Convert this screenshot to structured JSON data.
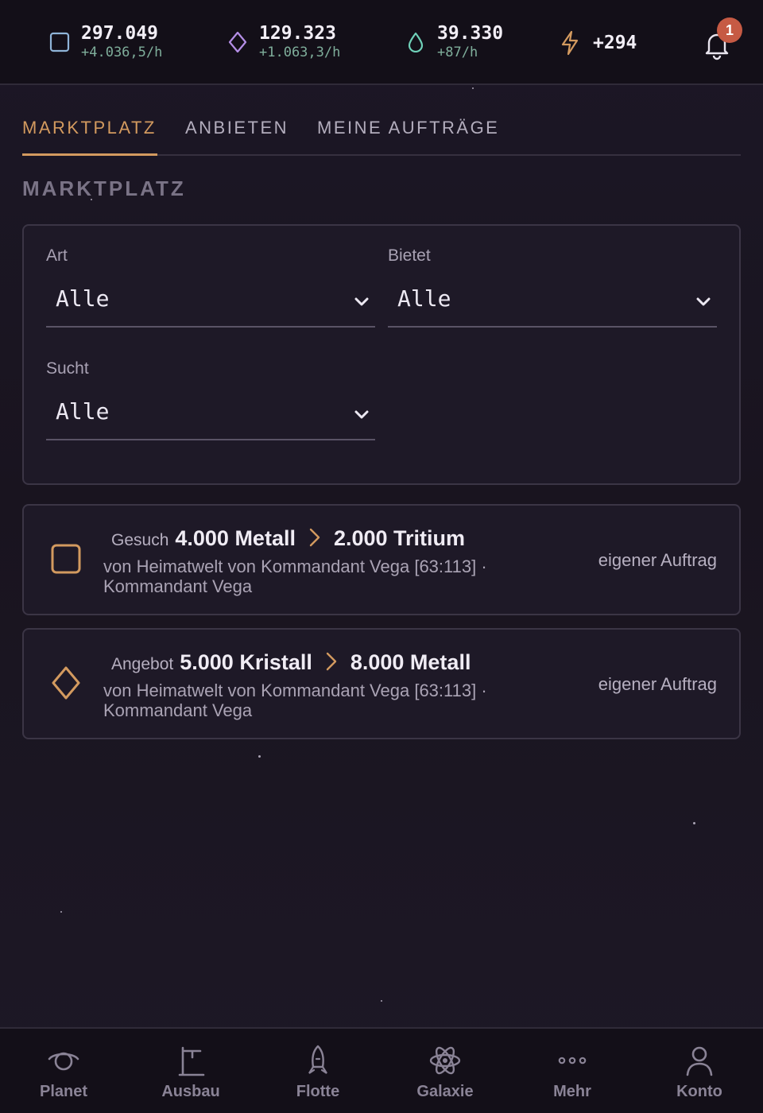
{
  "resources": [
    {
      "icon": "square-icon",
      "value": "297.049",
      "rate": "+4.036,5/h",
      "color": "#8fb4d8"
    },
    {
      "icon": "diamond-icon",
      "value": "129.323",
      "rate": "+1.063,3/h",
      "color": "#b48ee6"
    },
    {
      "icon": "droplet-icon",
      "value": "39.330",
      "rate": "+87/h",
      "color": "#6fd0b8"
    }
  ],
  "energy": {
    "icon": "bolt-icon",
    "value": "+294",
    "color": "#d39a5f"
  },
  "notifications": {
    "count": "1"
  },
  "tabs": [
    {
      "label": "MARKTPLATZ",
      "active": true
    },
    {
      "label": "ANBIETEN",
      "active": false
    },
    {
      "label": "MEINE AUFTRÄGE",
      "active": false
    }
  ],
  "section_title": "MARKTPLATZ",
  "filters": {
    "art": {
      "label": "Art",
      "value": "Alle"
    },
    "bietet": {
      "label": "Bietet",
      "value": "Alle"
    },
    "sucht": {
      "label": "Sucht",
      "value": "Alle"
    }
  },
  "orders": [
    {
      "icon": "square-icon",
      "kind": "Gesuch",
      "give": "4.000 Metall",
      "get": "2.000 Tritium",
      "source": "von Heimatwelt von Kommandant Vega [63:113] · Kommandant Vega",
      "status": "eigener Auftrag"
    },
    {
      "icon": "diamond-icon",
      "kind": "Angebot",
      "give": "5.000 Kristall",
      "get": "8.000 Metall",
      "source": "von Heimatwelt von Kommandant Vega [63:113] · Kommandant Vega",
      "status": "eigener Auftrag"
    }
  ],
  "nav": [
    {
      "icon": "planet-icon",
      "label": "Planet"
    },
    {
      "icon": "construction-icon",
      "label": "Ausbau"
    },
    {
      "icon": "rocket-icon",
      "label": "Flotte"
    },
    {
      "icon": "atom-icon",
      "label": "Galaxie"
    },
    {
      "icon": "more-icon",
      "label": "Mehr"
    },
    {
      "icon": "user-icon",
      "label": "Konto"
    }
  ],
  "accent_color": "#d39a5f"
}
